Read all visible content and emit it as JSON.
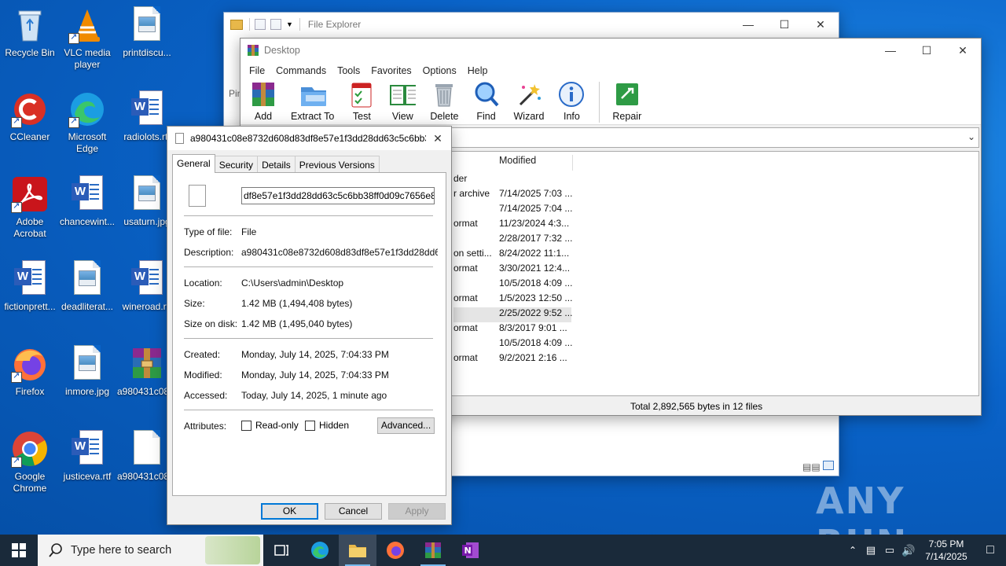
{
  "desktop": {
    "icons": [
      {
        "label": "Recycle Bin"
      },
      {
        "label": "VLC media player"
      },
      {
        "label": "printdiscu..."
      },
      {
        "label": "CCleaner"
      },
      {
        "label": "Microsoft Edge"
      },
      {
        "label": "radiolots.rtf"
      },
      {
        "label": "Adobe Acrobat"
      },
      {
        "label": "chancewint..."
      },
      {
        "label": "usaturn.jpg"
      },
      {
        "label": "fictionprett..."
      },
      {
        "label": "deadliterat..."
      },
      {
        "label": "wineroad.rtf"
      },
      {
        "label": "Firefox"
      },
      {
        "label": "inmore.jpg"
      },
      {
        "label": "a980431c08..."
      },
      {
        "label": "Google Chrome"
      },
      {
        "label": "justiceva.rtf"
      },
      {
        "label": "a980431c08..."
      }
    ],
    "watermark": "ANY RUN"
  },
  "explorer": {
    "title": "File Explorer",
    "partial_label": "Pin"
  },
  "winrar": {
    "title": "Desktop",
    "menu": [
      "File",
      "Commands",
      "Tools",
      "Favorites",
      "Options",
      "Help"
    ],
    "toolbar": [
      "Add",
      "Extract To",
      "Test",
      "View",
      "Delete",
      "Find",
      "Wizard",
      "Info",
      "Repair"
    ],
    "column_modified": "Modified",
    "rows": [
      {
        "type": "der",
        "modified": ""
      },
      {
        "type": "r archive",
        "modified": "7/14/2025 7:03 ..."
      },
      {
        "type": "",
        "modified": "7/14/2025 7:04 ..."
      },
      {
        "type": "ormat",
        "modified": "11/23/2024 4:3..."
      },
      {
        "type": "",
        "modified": "2/28/2017 7:32 ..."
      },
      {
        "type": "on setti...",
        "modified": "8/24/2022 11:1..."
      },
      {
        "type": "ormat",
        "modified": "3/30/2021 12:4..."
      },
      {
        "type": "",
        "modified": "10/5/2018 4:09 ..."
      },
      {
        "type": "ormat",
        "modified": "1/5/2023 12:50 ..."
      },
      {
        "type": "",
        "modified": "2/25/2022 9:52 ..."
      },
      {
        "type": "ormat",
        "modified": "8/3/2017 9:01 ..."
      },
      {
        "type": "",
        "modified": "10/5/2018 4:09 ..."
      },
      {
        "type": "ormat",
        "modified": "9/2/2021 2:16 ..."
      }
    ],
    "status": "Total 2,892,565 bytes in 12 files"
  },
  "props": {
    "title": "a980431c08e8732d608d83df8e57e1f3dd28dd63c5c6bb3...",
    "tabs": [
      "General",
      "Security",
      "Details",
      "Previous Versions"
    ],
    "filename": "df8e57e1f3dd28dd63c5c6bb38ff0d09c7656e8e57",
    "type_label": "Type of file:",
    "type_value": "File",
    "desc_label": "Description:",
    "desc_value": "a980431c08e8732d608d83df8e57e1f3dd28dd63c5",
    "location_label": "Location:",
    "location_value": "C:\\Users\\admin\\Desktop",
    "size_label": "Size:",
    "size_value": "1.42 MB (1,494,408 bytes)",
    "sizeondisk_label": "Size on disk:",
    "sizeondisk_value": "1.42 MB (1,495,040 bytes)",
    "created_label": "Created:",
    "created_value": "Monday, July 14, 2025, 7:04:33 PM",
    "modified_label": "Modified:",
    "modified_value": "Monday, July 14, 2025, 7:04:33 PM",
    "accessed_label": "Accessed:",
    "accessed_value": "Today, July 14, 2025, 1 minute ago",
    "attributes_label": "Attributes:",
    "readonly_label": "Read-only",
    "hidden_label": "Hidden",
    "advanced_label": "Advanced...",
    "ok_label": "OK",
    "cancel_label": "Cancel",
    "apply_label": "Apply"
  },
  "taskbar": {
    "search_placeholder": "Type here to search",
    "time": "7:05 PM",
    "date": "7/14/2025"
  }
}
